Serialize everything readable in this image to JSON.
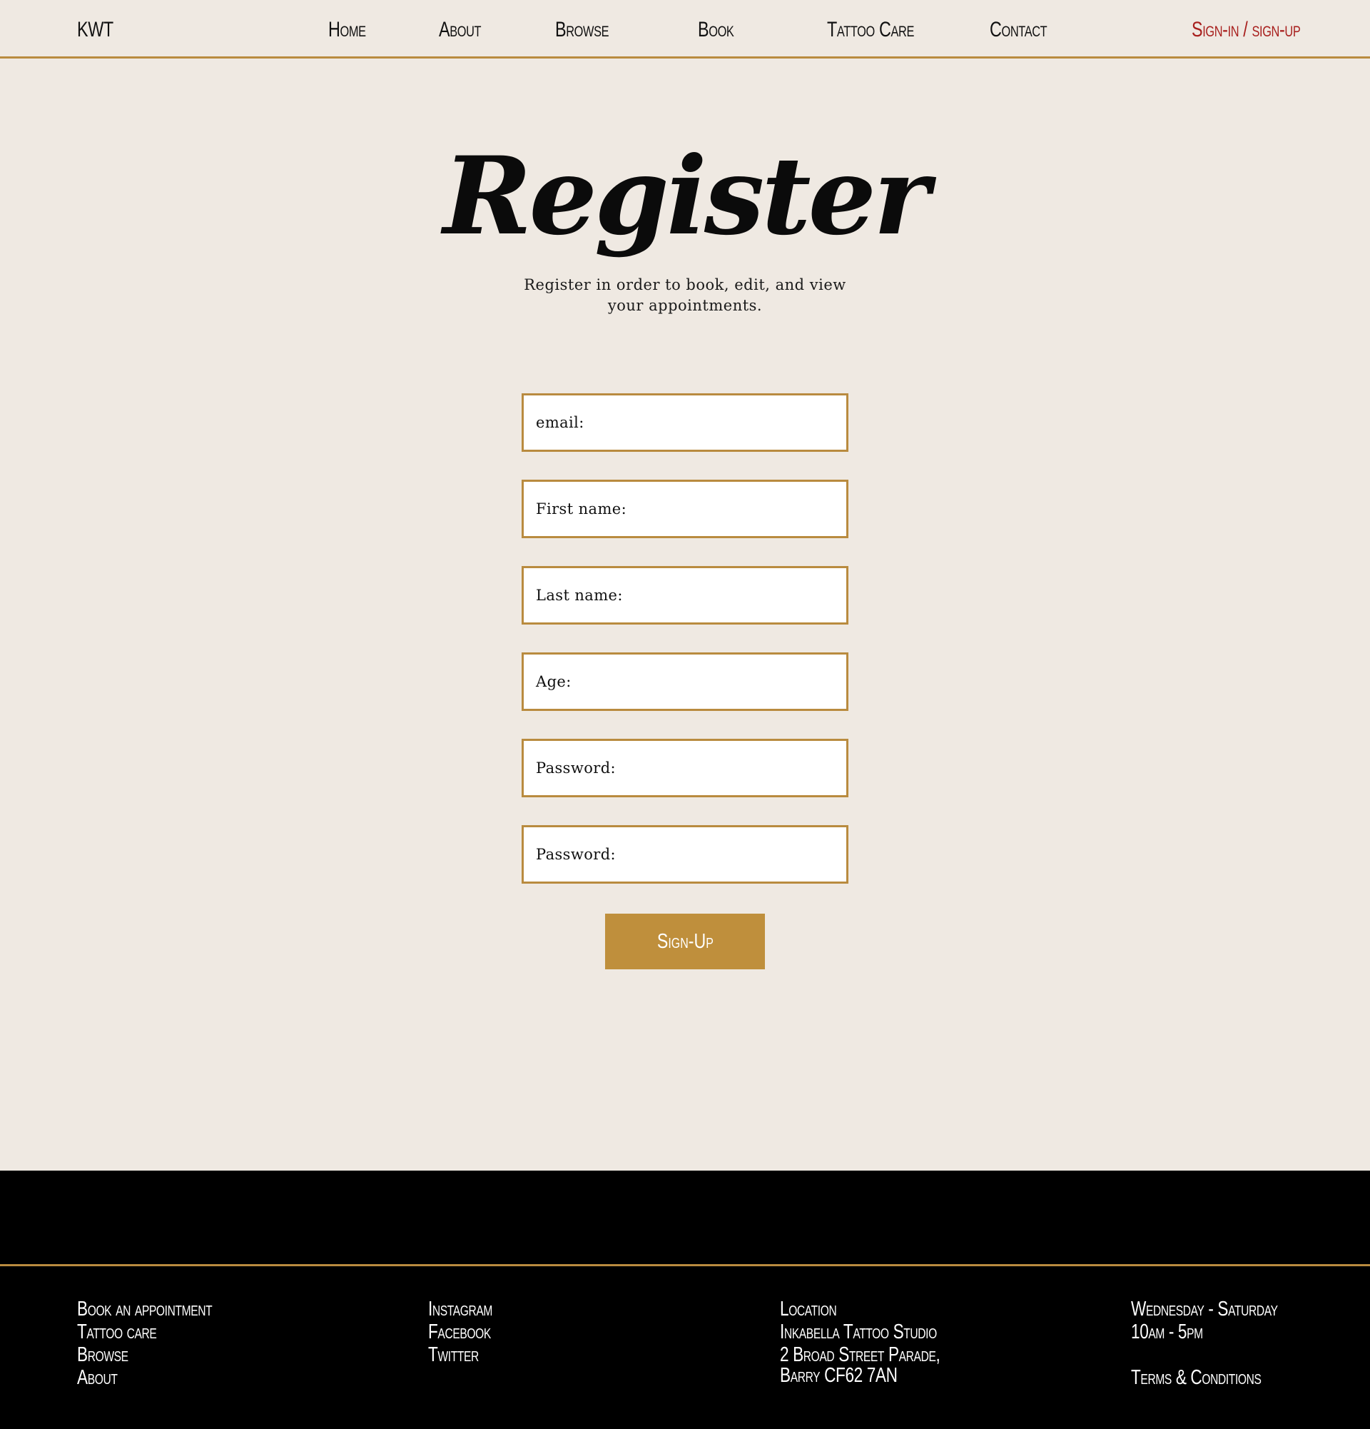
{
  "nav": {
    "brand": "KWT",
    "links": [
      "Home",
      "About",
      "Browse",
      "Book",
      "Tattoo Care",
      "Contact"
    ],
    "auth": "Sign-in / sign-up",
    "accent_color": "#a8201e"
  },
  "register": {
    "title": "Register",
    "subtitle": "Register in order to book, edit, and view your appointments.",
    "fields": [
      {
        "label": "email:"
      },
      {
        "label": "First name:"
      },
      {
        "label": "Last name:"
      },
      {
        "label": "Age:"
      },
      {
        "label": "Password:"
      },
      {
        "label": "Password:"
      }
    ],
    "submit_label": "Sign-Up",
    "border_color": "#b98b3f",
    "button_color": "#bf8f3c"
  },
  "footer": {
    "links": [
      "Book an appointment",
      "Tattoo care",
      "Browse",
      "About"
    ],
    "social": [
      "Instagram",
      "Facebook",
      "Twitter"
    ],
    "location": {
      "heading": "Location",
      "name": "Inkabella Tattoo Studio",
      "address_line1": "2 Broad Street Parade,",
      "address_line2": "Barry CF62 7AN"
    },
    "hours": {
      "days": "Wednesday - Saturday",
      "times": "10am - 5pm"
    },
    "terms": "Terms & Conditions",
    "background_color": "#000000"
  }
}
